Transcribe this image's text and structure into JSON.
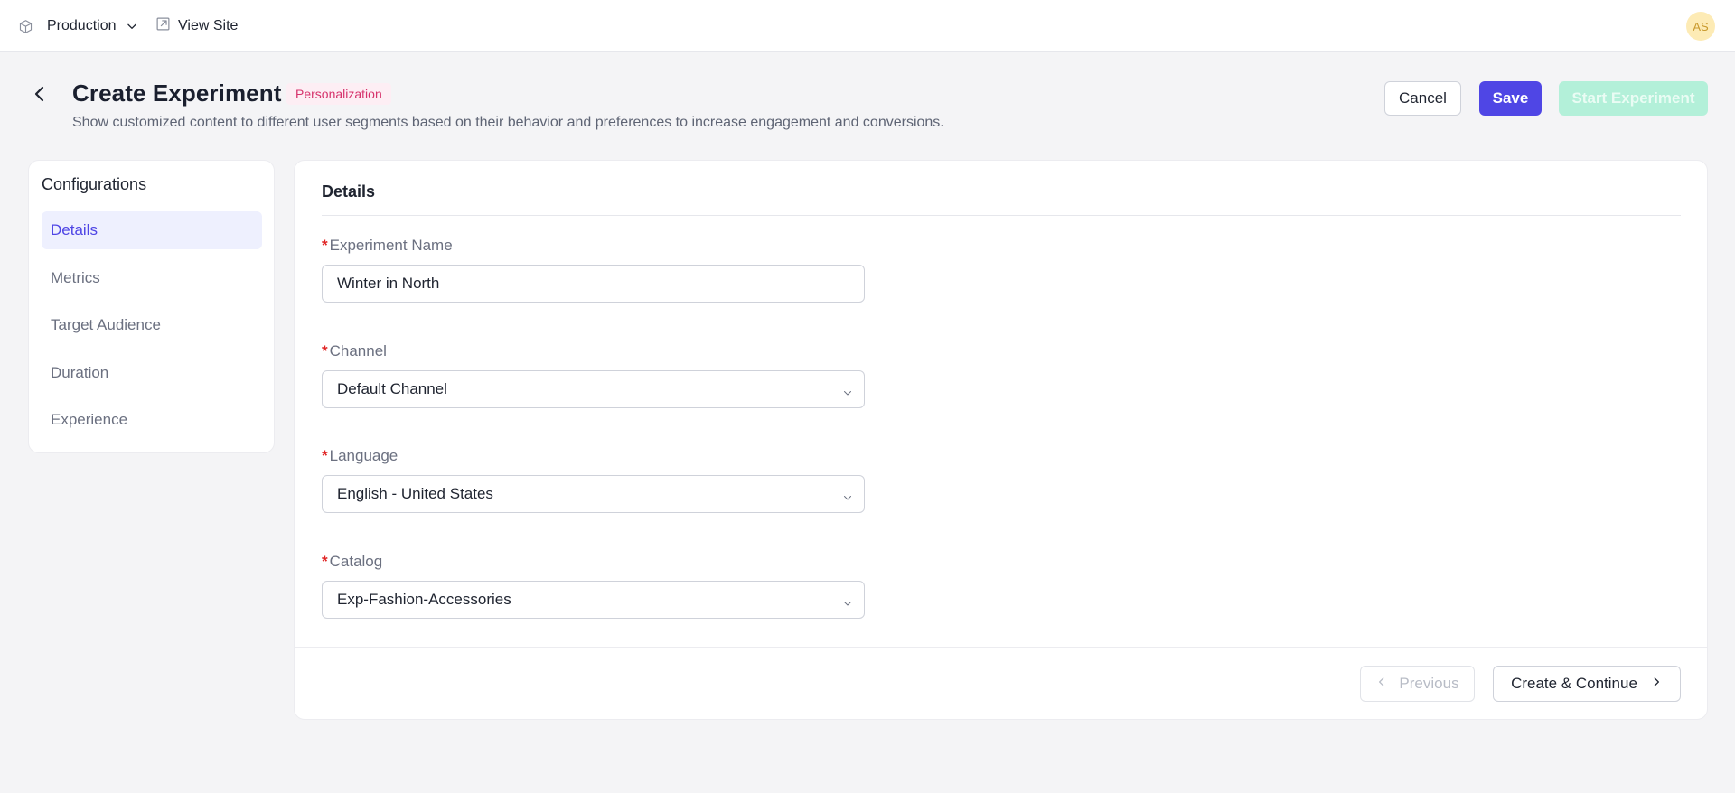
{
  "topbar": {
    "environment": "Production",
    "view_site": "View Site",
    "avatar_initials": "AS"
  },
  "header": {
    "title": "Create Experiment",
    "tag": "Personalization",
    "subtitle": "Show customized content to different user segments based on their behavior and preferences to increase engagement and conversions.",
    "cancel_label": "Cancel",
    "save_label": "Save",
    "start_label": "Start Experiment"
  },
  "sidebar": {
    "title": "Configurations",
    "items": [
      {
        "label": "Details",
        "active": true
      },
      {
        "label": "Metrics",
        "active": false
      },
      {
        "label": "Target Audience",
        "active": false
      },
      {
        "label": "Duration",
        "active": false
      },
      {
        "label": "Experience",
        "active": false
      }
    ]
  },
  "details": {
    "title": "Details",
    "required_mark": "*",
    "experiment_name": {
      "label": "Experiment Name",
      "value": "Winter in North"
    },
    "channel": {
      "label": "Channel",
      "value": "Default Channel"
    },
    "language": {
      "label": "Language",
      "value": "English - United States"
    },
    "catalog": {
      "label": "Catalog",
      "value": "Exp-Fashion-Accessories"
    }
  },
  "footer": {
    "previous_label": "Previous",
    "next_label": "Create & Continue"
  },
  "colors": {
    "accent": "#4f46e5",
    "start_disabled": "#b3f0d9",
    "tag_text": "#d6336c",
    "required": "#e02424",
    "avatar_bg": "#fdebb5"
  }
}
